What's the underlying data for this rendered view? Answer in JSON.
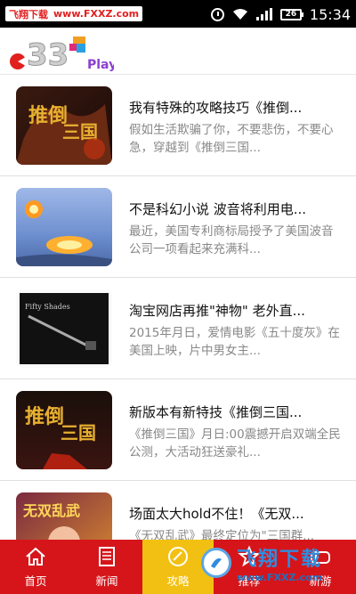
{
  "status_bar": {
    "watermark_left": "飞翔下载",
    "watermark_url": "www.FXXZ.com",
    "battery": "26",
    "time": "15:34"
  },
  "header": {
    "logo_icon": "33play-logo",
    "logo_text": "Play!"
  },
  "articles": [
    {
      "title": "我有特殊的攻略技巧《推倒...",
      "desc": "假如生活欺骗了你，不要悲伤，不要心急，穿越到《推倒三国..."
    },
    {
      "title": "不是科幻小说 波音将利用电...",
      "desc": "最近，美国专利商标局授予了美国波音公司一项看起来充满科..."
    },
    {
      "title": "淘宝网店再推\"神物\" 老外直...",
      "desc": "2015年月日，爱情电影《五十度灰》在美国上映，片中男女主..."
    },
    {
      "title": "新版本有新特技《推倒三国...",
      "desc": "《推倒三国》月日:00震撼开启双端全民公测，大活动狂送豪礼..."
    },
    {
      "title": "场面太大hold不住！《无双...",
      "desc": "《无双乱武》最终定位为\"三国群..."
    }
  ],
  "thumbnail_text": {
    "fifty_shades": "Fifty Shades"
  },
  "bottom_nav": [
    {
      "label": "首页",
      "icon": "home-icon"
    },
    {
      "label": "新闻",
      "icon": "news-icon"
    },
    {
      "label": "攻略",
      "icon": "strategy-icon"
    },
    {
      "label": "推荐",
      "icon": "recommend-icon"
    },
    {
      "label": "新游",
      "icon": "new-game-icon"
    }
  ],
  "watermark_bottom": {
    "title": "飞翔下载",
    "url": "www.FXXZ.com"
  },
  "colors": {
    "nav_red": "#d6151a",
    "nav_active": "#f2c012"
  }
}
